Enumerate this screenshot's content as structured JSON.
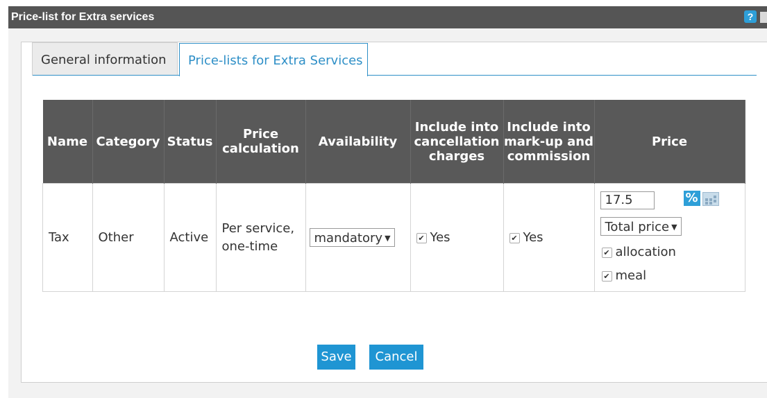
{
  "window": {
    "title": "Price-list for Extra services",
    "help_label": "?"
  },
  "tabs": [
    {
      "label": "General information",
      "active": false
    },
    {
      "label": "Price-lists for Extra Services",
      "active": true
    }
  ],
  "table": {
    "columns": [
      "Name",
      "Category",
      "Status",
      "Price calculation",
      "Availability",
      "Include into cancellation charges",
      "Include into mark-up and commission",
      "Price"
    ],
    "rows": [
      {
        "name": "Tax",
        "category": "Other",
        "status": "Active",
        "price_calculation": "Per service, one-time",
        "availability": "mandatory",
        "include_cancellation": {
          "checked": true,
          "label": "Yes"
        },
        "include_markup": {
          "checked": true,
          "label": "Yes"
        },
        "price": {
          "value": "17.5",
          "percent_icon": "%",
          "mode": "Total price",
          "options": [
            {
              "label": "allocation",
              "checked": true
            },
            {
              "label": "meal",
              "checked": true
            }
          ]
        }
      }
    ]
  },
  "buttons": {
    "save": "Save",
    "cancel": "Cancel"
  },
  "colors": {
    "title_bar": "#555555",
    "accent": "#1f95d3",
    "header_bg": "#595959"
  }
}
